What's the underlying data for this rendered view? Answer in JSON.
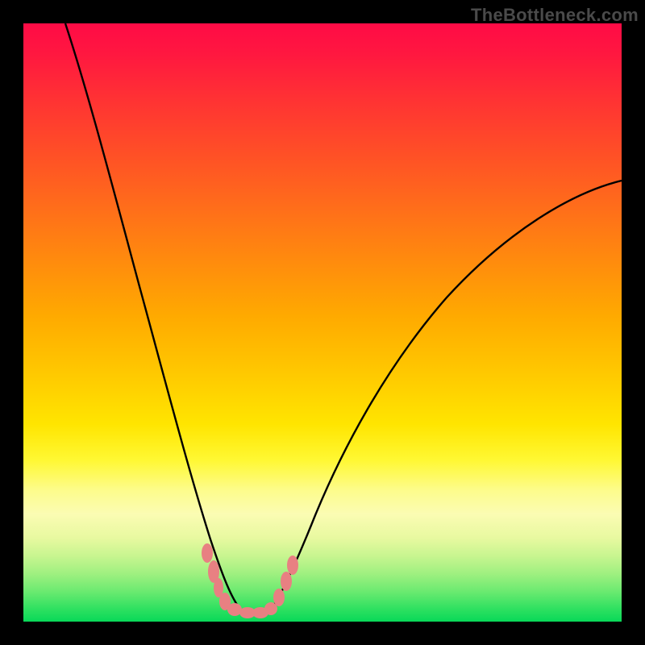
{
  "watermark": "TheBottleneck.com",
  "chart_data": {
    "type": "line",
    "title": "",
    "xlabel": "",
    "ylabel": "",
    "xlim": [
      0,
      100
    ],
    "ylim": [
      0,
      100
    ],
    "grid": false,
    "legend": false,
    "series": [
      {
        "name": "left-curve",
        "x": [
          7,
          10,
          14,
          18,
          22,
          25,
          28,
          30,
          32,
          33.5,
          35,
          36
        ],
        "values": [
          100,
          85,
          68,
          52,
          38,
          27,
          18,
          12,
          7,
          4,
          2,
          1.5
        ]
      },
      {
        "name": "right-curve",
        "x": [
          41,
          43,
          45,
          48,
          52,
          58,
          66,
          76,
          88,
          100
        ],
        "values": [
          1.5,
          3,
          7,
          14,
          24,
          37,
          50,
          60,
          67,
          72
        ]
      },
      {
        "name": "floor-band",
        "x": [
          30,
          33,
          35,
          36.5,
          38.5,
          40.5,
          42,
          43.5,
          45
        ],
        "values": [
          5.5,
          3.5,
          2.5,
          2,
          2,
          2,
          2.5,
          3.5,
          5.5
        ]
      }
    ],
    "annotations": [
      {
        "text": "TheBottleneck.com",
        "position": "top-right"
      }
    ],
    "background": {
      "type": "vertical-gradient",
      "stops": [
        {
          "pos": 0.0,
          "color": "#ff0b46"
        },
        {
          "pos": 0.4,
          "color": "#ff8c0d"
        },
        {
          "pos": 0.67,
          "color": "#ffe500"
        },
        {
          "pos": 0.82,
          "color": "#fbfcb3"
        },
        {
          "pos": 1.0,
          "color": "#08d858"
        }
      ]
    }
  },
  "colors": {
    "curve": "#000000",
    "marker": "#e88082",
    "frame": "#000000"
  }
}
